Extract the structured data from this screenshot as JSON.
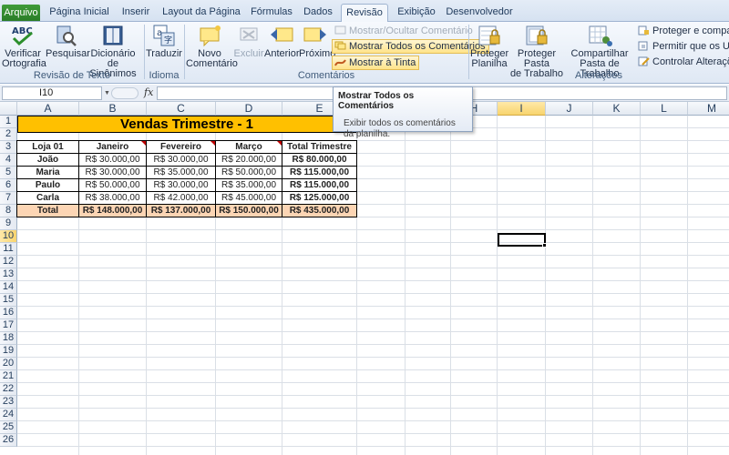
{
  "tabs": [
    "Arquivo",
    "Página Inicial",
    "Inserir",
    "Layout da Página",
    "Fórmulas",
    "Dados",
    "Revisão",
    "Exibição",
    "Desenvolvedor"
  ],
  "active_tab": "Revisão",
  "ribbon": {
    "groups": {
      "revisao": "Revisão de Texto",
      "idioma": "Idioma",
      "comentarios": "Comentários",
      "alteracoes": "Alterações"
    },
    "verificar": [
      "Verificar",
      "Ortografia"
    ],
    "pesquisar": "Pesquisar",
    "dicionario": [
      "Dicionário de",
      "Sinônimos"
    ],
    "traduzir": "Traduzir",
    "novo_comentario": [
      "Novo",
      "Comentário"
    ],
    "excluir": "Excluir",
    "anterior": "Anterior",
    "proximo": "Próximo",
    "mostrar_ocultar": "Mostrar/Ocultar Comentário",
    "mostrar_todos": "Mostrar Todos os Comentários",
    "mostrar_tinta": "Mostrar à Tinta",
    "proteger_planilha": [
      "Proteger",
      "Planilha"
    ],
    "proteger_pasta": [
      "Proteger Pasta",
      "de Trabalho"
    ],
    "compartilhar_pasta": [
      "Compartilhar",
      "Pasta de Trabalho"
    ],
    "proteger_compartilhar": "Proteger e compartilh",
    "permitir_usuarios": "Permitir que os Usuá",
    "controlar_alteracoes": "Controlar Alterações"
  },
  "formula_bar": {
    "name_box": "I10",
    "fx": "fx",
    "value": ""
  },
  "tooltip": {
    "title": "Mostrar Todos os Comentários",
    "body": "Exibir todos os comentários da planilha."
  },
  "sheet": {
    "columns": [
      "A",
      "B",
      "C",
      "D",
      "E",
      "F",
      "G",
      "H",
      "I",
      "J",
      "K",
      "L",
      "M"
    ],
    "selected_column": "I",
    "selected_row": 10,
    "rows": [
      1,
      2,
      3,
      4,
      5,
      6,
      7,
      8,
      9,
      10,
      11,
      12,
      13,
      14,
      15,
      16,
      17,
      18,
      19,
      20,
      21,
      22,
      23,
      24,
      25,
      26
    ],
    "title": "Vendas Trimestre - 1",
    "headers": [
      "Loja 01",
      "Janeiro",
      "Fevereiro",
      "Março",
      "Total Trimestre"
    ],
    "data": [
      [
        "João",
        "R$ 30.000,00",
        "R$ 30.000,00",
        "R$ 20.000,00",
        "R$ 80.000,00"
      ],
      [
        "Maria",
        "R$ 30.000,00",
        "R$ 35.000,00",
        "R$ 50.000,00",
        "R$ 115.000,00"
      ],
      [
        "Paulo",
        "R$ 50.000,00",
        "R$ 30.000,00",
        "R$ 35.000,00",
        "R$ 115.000,00"
      ],
      [
        "Carla",
        "R$ 38.000,00",
        "R$ 42.000,00",
        "R$ 45.000,00",
        "R$ 125.000,00"
      ]
    ],
    "total": [
      "Total",
      "R$ 148.000,00",
      "R$ 137.000,00",
      "R$ 150.000,00",
      "R$ 435.000,00"
    ]
  },
  "colors": {
    "title_fill": "#ffc000",
    "total_fill": "#fcd5b4",
    "comment_marker": "#c00000",
    "file_tab": "#2a7d27"
  }
}
